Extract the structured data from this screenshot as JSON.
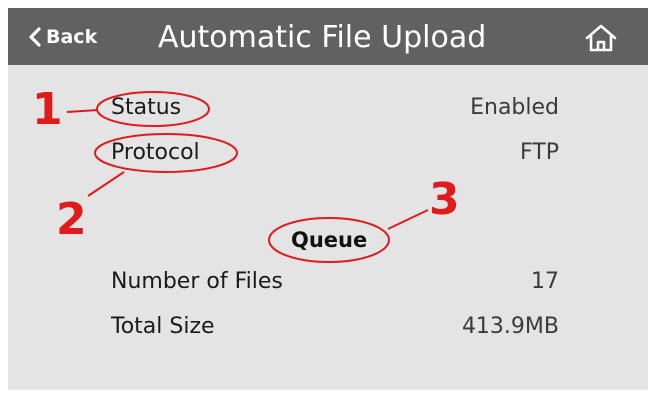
{
  "header": {
    "back_label": "Back",
    "title": "Automatic File Upload"
  },
  "settings": {
    "status": {
      "label": "Status",
      "value": "Enabled"
    },
    "protocol": {
      "label": "Protocol",
      "value": "FTP"
    }
  },
  "queue": {
    "heading": "Queue",
    "number_of_files": {
      "label": "Number of Files",
      "value": "17"
    },
    "total_size": {
      "label": "Total Size",
      "value": "413.9MB"
    }
  },
  "annotations": {
    "marker_1": "1",
    "marker_2": "2",
    "marker_3": "3",
    "color": "#e01b1b"
  },
  "icons": {
    "back": "chevron-left-icon",
    "home": "home-icon"
  }
}
